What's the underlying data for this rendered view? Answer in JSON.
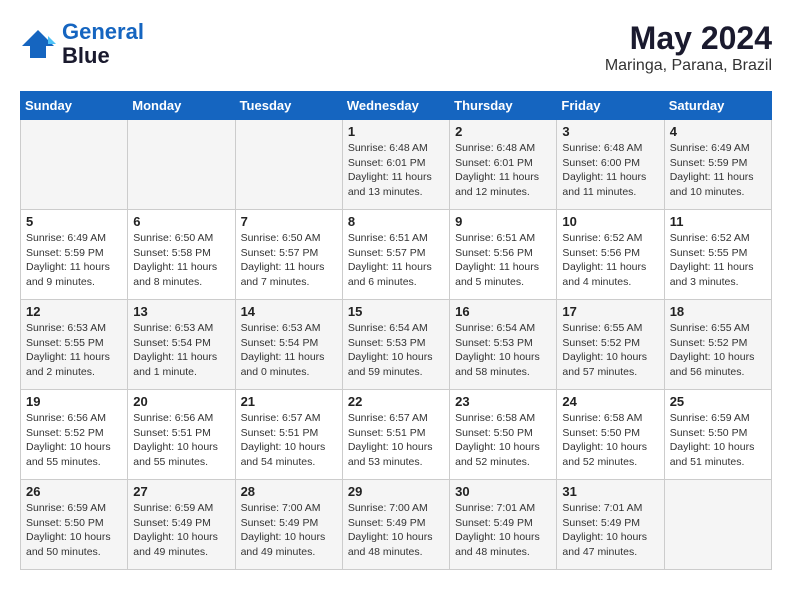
{
  "logo": {
    "line1": "General",
    "line2": "Blue"
  },
  "title": {
    "month_year": "May 2024",
    "location": "Maringa, Parana, Brazil"
  },
  "weekdays": [
    "Sunday",
    "Monday",
    "Tuesday",
    "Wednesday",
    "Thursday",
    "Friday",
    "Saturday"
  ],
  "weeks": [
    [
      {
        "day": "",
        "content": ""
      },
      {
        "day": "",
        "content": ""
      },
      {
        "day": "",
        "content": ""
      },
      {
        "day": "1",
        "content": "Sunrise: 6:48 AM\nSunset: 6:01 PM\nDaylight: 11 hours and 13 minutes."
      },
      {
        "day": "2",
        "content": "Sunrise: 6:48 AM\nSunset: 6:01 PM\nDaylight: 11 hours and 12 minutes."
      },
      {
        "day": "3",
        "content": "Sunrise: 6:48 AM\nSunset: 6:00 PM\nDaylight: 11 hours and 11 minutes."
      },
      {
        "day": "4",
        "content": "Sunrise: 6:49 AM\nSunset: 5:59 PM\nDaylight: 11 hours and 10 minutes."
      }
    ],
    [
      {
        "day": "5",
        "content": "Sunrise: 6:49 AM\nSunset: 5:59 PM\nDaylight: 11 hours and 9 minutes."
      },
      {
        "day": "6",
        "content": "Sunrise: 6:50 AM\nSunset: 5:58 PM\nDaylight: 11 hours and 8 minutes."
      },
      {
        "day": "7",
        "content": "Sunrise: 6:50 AM\nSunset: 5:57 PM\nDaylight: 11 hours and 7 minutes."
      },
      {
        "day": "8",
        "content": "Sunrise: 6:51 AM\nSunset: 5:57 PM\nDaylight: 11 hours and 6 minutes."
      },
      {
        "day": "9",
        "content": "Sunrise: 6:51 AM\nSunset: 5:56 PM\nDaylight: 11 hours and 5 minutes."
      },
      {
        "day": "10",
        "content": "Sunrise: 6:52 AM\nSunset: 5:56 PM\nDaylight: 11 hours and 4 minutes."
      },
      {
        "day": "11",
        "content": "Sunrise: 6:52 AM\nSunset: 5:55 PM\nDaylight: 11 hours and 3 minutes."
      }
    ],
    [
      {
        "day": "12",
        "content": "Sunrise: 6:53 AM\nSunset: 5:55 PM\nDaylight: 11 hours and 2 minutes."
      },
      {
        "day": "13",
        "content": "Sunrise: 6:53 AM\nSunset: 5:54 PM\nDaylight: 11 hours and 1 minute."
      },
      {
        "day": "14",
        "content": "Sunrise: 6:53 AM\nSunset: 5:54 PM\nDaylight: 11 hours and 0 minutes."
      },
      {
        "day": "15",
        "content": "Sunrise: 6:54 AM\nSunset: 5:53 PM\nDaylight: 10 hours and 59 minutes."
      },
      {
        "day": "16",
        "content": "Sunrise: 6:54 AM\nSunset: 5:53 PM\nDaylight: 10 hours and 58 minutes."
      },
      {
        "day": "17",
        "content": "Sunrise: 6:55 AM\nSunset: 5:52 PM\nDaylight: 10 hours and 57 minutes."
      },
      {
        "day": "18",
        "content": "Sunrise: 6:55 AM\nSunset: 5:52 PM\nDaylight: 10 hours and 56 minutes."
      }
    ],
    [
      {
        "day": "19",
        "content": "Sunrise: 6:56 AM\nSunset: 5:52 PM\nDaylight: 10 hours and 55 minutes."
      },
      {
        "day": "20",
        "content": "Sunrise: 6:56 AM\nSunset: 5:51 PM\nDaylight: 10 hours and 55 minutes."
      },
      {
        "day": "21",
        "content": "Sunrise: 6:57 AM\nSunset: 5:51 PM\nDaylight: 10 hours and 54 minutes."
      },
      {
        "day": "22",
        "content": "Sunrise: 6:57 AM\nSunset: 5:51 PM\nDaylight: 10 hours and 53 minutes."
      },
      {
        "day": "23",
        "content": "Sunrise: 6:58 AM\nSunset: 5:50 PM\nDaylight: 10 hours and 52 minutes."
      },
      {
        "day": "24",
        "content": "Sunrise: 6:58 AM\nSunset: 5:50 PM\nDaylight: 10 hours and 52 minutes."
      },
      {
        "day": "25",
        "content": "Sunrise: 6:59 AM\nSunset: 5:50 PM\nDaylight: 10 hours and 51 minutes."
      }
    ],
    [
      {
        "day": "26",
        "content": "Sunrise: 6:59 AM\nSunset: 5:50 PM\nDaylight: 10 hours and 50 minutes."
      },
      {
        "day": "27",
        "content": "Sunrise: 6:59 AM\nSunset: 5:49 PM\nDaylight: 10 hours and 49 minutes."
      },
      {
        "day": "28",
        "content": "Sunrise: 7:00 AM\nSunset: 5:49 PM\nDaylight: 10 hours and 49 minutes."
      },
      {
        "day": "29",
        "content": "Sunrise: 7:00 AM\nSunset: 5:49 PM\nDaylight: 10 hours and 48 minutes."
      },
      {
        "day": "30",
        "content": "Sunrise: 7:01 AM\nSunset: 5:49 PM\nDaylight: 10 hours and 48 minutes."
      },
      {
        "day": "31",
        "content": "Sunrise: 7:01 AM\nSunset: 5:49 PM\nDaylight: 10 hours and 47 minutes."
      },
      {
        "day": "",
        "content": ""
      }
    ]
  ]
}
